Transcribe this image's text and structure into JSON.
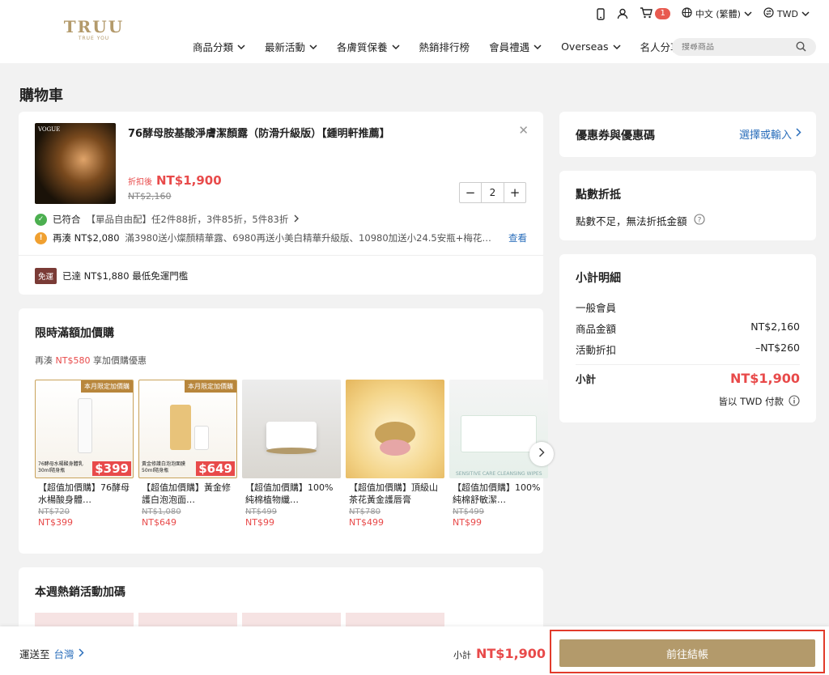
{
  "brand": {
    "name": "TRUU",
    "tagline": "TRUE YOU",
    "color": "#b39a6b"
  },
  "topbar": {
    "cart_count": "1",
    "language": "中文 (繁體)",
    "currency": "TWD"
  },
  "nav": [
    {
      "label": "商品分類",
      "has_dropdown": true
    },
    {
      "label": "最新活動",
      "has_dropdown": true
    },
    {
      "label": "各膚質保養",
      "has_dropdown": true
    },
    {
      "label": "熱銷排行榜",
      "has_dropdown": false
    },
    {
      "label": "會員禮遇",
      "has_dropdown": true
    },
    {
      "label": "Overseas",
      "has_dropdown": true
    },
    {
      "label": "名人分享",
      "has_dropdown": false
    }
  ],
  "search": {
    "placeholder": "搜尋商品"
  },
  "page_title": "購物車",
  "cart_item": {
    "image_label": "VOGUE",
    "name": "76酵母胺基酸淨膚潔顏露（防滑升級版）【鍾明軒推薦】",
    "discount_label": "折扣後",
    "discount_price": "NT$1,900",
    "original_price": "NT$2,160",
    "quantity": "2",
    "promo_matched_label": "已符合",
    "promo_matched_text": "【單品自由配】任2件88折，3件85折，5件83折",
    "promo_more_label": "再湊 NT$2,080",
    "promo_more_text": "滿3980送小燦顏精華露、6980再送小美白精華升級版、10980加送小24.5安瓶+梅花…",
    "promo_more_link": "查看",
    "free_ship_badge": "免運",
    "free_ship_text": "已達 NT$1,880 最低免運門檻"
  },
  "addon": {
    "title": "限時滿額加價購",
    "sub_prefix": "再湊",
    "sub_amount": "NT$580",
    "sub_suffix": "享加價購優惠",
    "items": [
      {
        "name": "【超值加價購】76酵母水楊酸身體…",
        "orig": "NT$720",
        "price": "NT$399",
        "ribbon": "本月限定加價購",
        "badge": "$399",
        "img_caption": "76酵母水楊酸身體乳 30ml隨身瓶"
      },
      {
        "name": "【超值加價購】黃金修護白泡泡面…",
        "orig": "NT$1,080",
        "price": "NT$649",
        "ribbon": "本月限定加價購",
        "badge": "$649",
        "img_caption": "黃金修護白泡泡面膜 50ml隨身瓶"
      },
      {
        "name": "【超值加價購】100%純棉植物纖…",
        "orig": "NT$499",
        "price": "NT$99",
        "ribbon": "",
        "badge": "",
        "img_caption": ""
      },
      {
        "name": "【超值加價購】頂級山茶花黃金護唇膏",
        "orig": "NT$780",
        "price": "NT$499",
        "ribbon": "",
        "badge": "",
        "img_caption": ""
      },
      {
        "name": "【超值加價購】100%純棉舒敏潔…",
        "orig": "NT$499",
        "price": "NT$99",
        "ribbon": "",
        "badge": "",
        "img_caption": "SENSITIVE CARE CLEANSING WIPES"
      }
    ]
  },
  "weekly": {
    "title": "本週熱銷活動加碼"
  },
  "coupon": {
    "title": "優惠券與優惠碼",
    "link": "選擇或輸入"
  },
  "points": {
    "title": "點數折抵",
    "note": "點數不足，無法折抵金額"
  },
  "summary": {
    "title": "小計明細",
    "member": "一般會員",
    "rows": [
      {
        "label": "商品金額",
        "value": "NT$2,160"
      },
      {
        "label": "活動折扣",
        "value": "–NT$260"
      }
    ],
    "subtotal_label": "小計",
    "subtotal": "NT$1,900",
    "currency_note": "皆以 TWD 付款"
  },
  "footer": {
    "ship_label": "運送至",
    "ship_country": "台灣",
    "subtotal_label": "小計",
    "subtotal": "NT$1,900",
    "checkout": "前往結帳"
  }
}
